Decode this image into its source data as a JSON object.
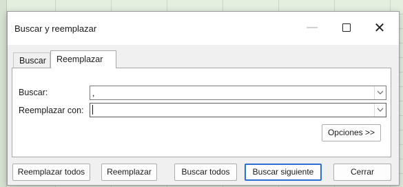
{
  "window": {
    "title": "Buscar y reemplazar",
    "minimize_glyph": "—",
    "close_glyph": "✕"
  },
  "tabs": [
    {
      "label": "Buscar",
      "selected": false
    },
    {
      "label": "Reemplazar",
      "selected": true
    }
  ],
  "fields": {
    "find": {
      "label": "Buscar:",
      "value": ","
    },
    "replace": {
      "label": "Reemplazar con:",
      "value": ""
    }
  },
  "buttons": {
    "options": "Opciones >>",
    "replace_all": "Reemplazar todos",
    "replace": "Reemplazar",
    "find_all": "Buscar todos",
    "find_next": "Buscar siguiente",
    "close": "Cerrar"
  },
  "colors": {
    "default_button_border": "#2b6fd6",
    "dialog_background": "#f0f0f0"
  },
  "icons": [
    "minimize-icon",
    "maximize-icon",
    "close-icon",
    "chevron-down-icon"
  ]
}
